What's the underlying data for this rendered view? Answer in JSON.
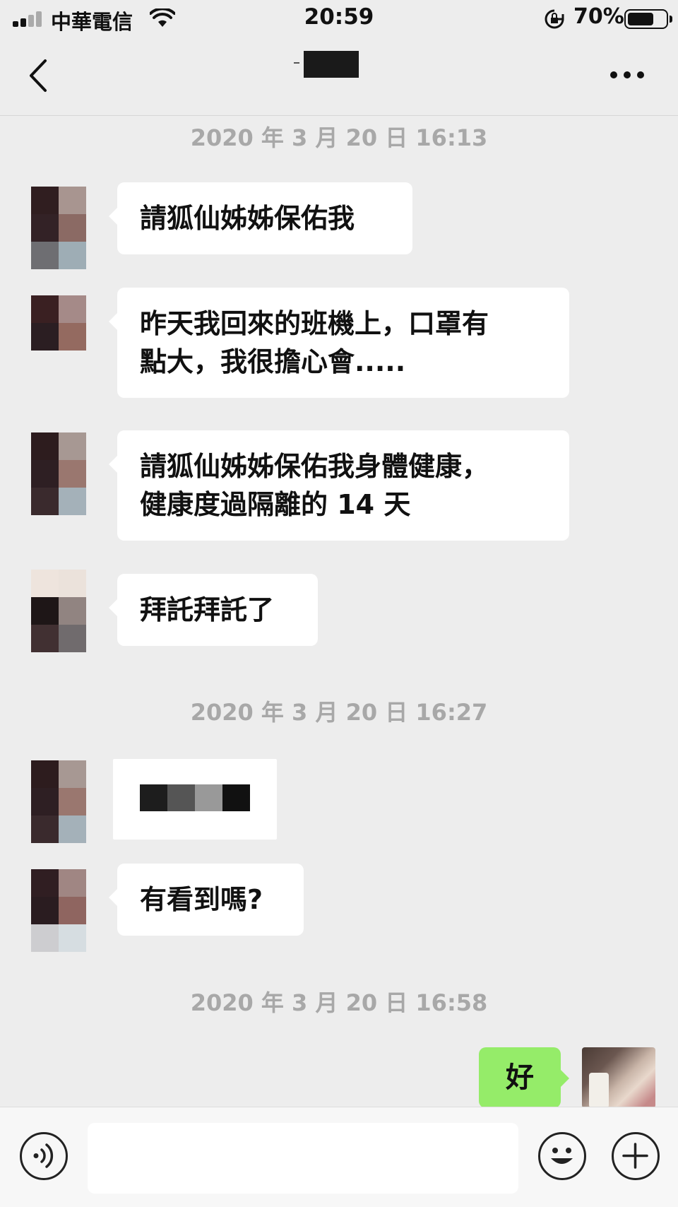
{
  "status_bar": {
    "carrier": "中華電信",
    "time": "20:59",
    "battery_percent": "70%",
    "battery_level": 0.7
  },
  "nav": {
    "back_icon": "chevron-left-icon",
    "more_icon": "more-horizontal-icon",
    "title_redacted": true
  },
  "messages": {
    "ts1": "2020 年 3 月 20 日 16:13",
    "m1": "請狐仙姊姊保佑我",
    "m2_line1": "昨天我回來的班機上，口罩有",
    "m2_line2": "點大，我很擔心會.....",
    "m3_line1": "請狐仙姊姊保佑我身體健康，",
    "m3_line2": "健康度過隔離的 14 天",
    "m4": "拜託拜託了",
    "ts2": "2020 年 3 月 20 日 16:27",
    "m5_redacted": true,
    "m6": "有看到嗎?",
    "ts3": "2020 年 3 月 20 日 16:58",
    "m7_me": "好"
  },
  "input_bar": {
    "voice_icon": "voice-icon",
    "emoji_icon": "emoji-icon",
    "plus_icon": "plus-icon"
  },
  "colors": {
    "background": "#ededed",
    "my_bubble": "#95ec69",
    "their_bubble": "#ffffff",
    "timestamp": "#a8a8a8"
  }
}
